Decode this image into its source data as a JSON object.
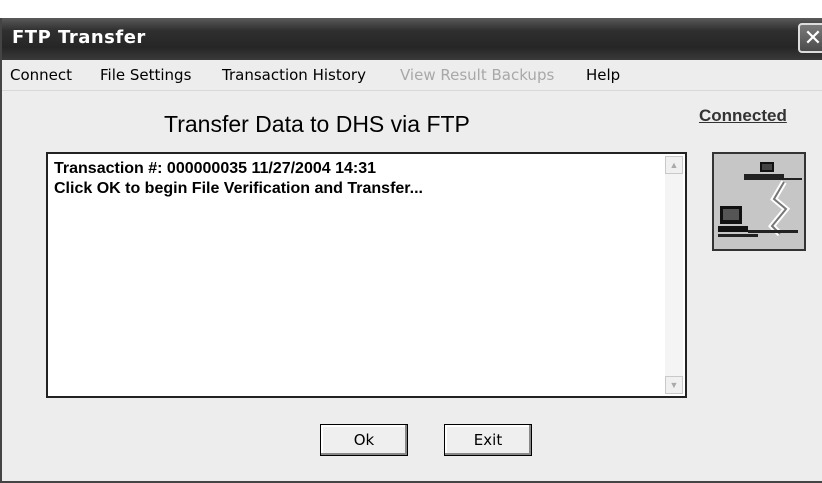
{
  "window": {
    "title": "FTP Transfer",
    "close_label": "✕"
  },
  "menu": {
    "items": [
      {
        "label": "Connect",
        "enabled": true
      },
      {
        "label": "File Settings",
        "enabled": true
      },
      {
        "label": "Transaction History",
        "enabled": true
      },
      {
        "label": "View Result Backups",
        "enabled": false
      },
      {
        "label": "Help",
        "enabled": true
      }
    ]
  },
  "main": {
    "heading": "Transfer Data to DHS via FTP",
    "status": "Connected",
    "log_lines": [
      "Transaction #: 000000035    11/27/2004 14:31",
      "Click OK to begin File Verification and Transfer..."
    ]
  },
  "buttons": {
    "ok_label": "Ok",
    "exit_label": "Exit"
  },
  "icons": {
    "status_icon": "network-computers-icon",
    "scroll_up": "scroll-up-icon",
    "scroll_down": "scroll-down-icon"
  }
}
